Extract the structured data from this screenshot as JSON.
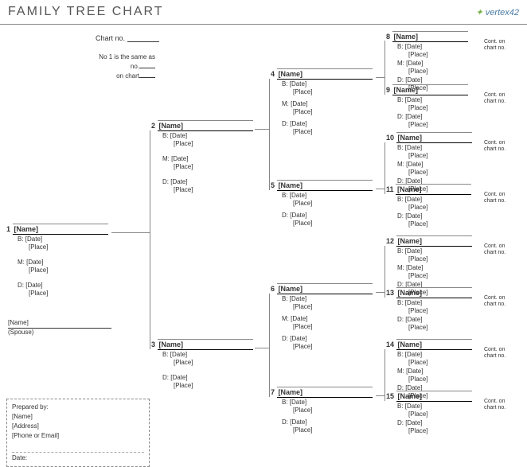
{
  "header": {
    "title": "FAMILY TREE CHART",
    "logo": "vertex42"
  },
  "chartno": {
    "label": "Chart no.",
    "value": ""
  },
  "instructions": {
    "line1": "No 1 is the same as",
    "line2": "no.",
    "line3": "on chart"
  },
  "labels": {
    "b": "B:",
    "m": "M:",
    "d": "D:",
    "date": "[Date]",
    "place": "[Place]",
    "name": "[Name]",
    "cont": "Cont. on chart no."
  },
  "spouse": {
    "label": "(Spouse)",
    "name": "[Name]"
  },
  "prep": {
    "by": "Prepared by:",
    "name": "[Name]",
    "addr": "[Address]",
    "phone": "[Phone or Email]",
    "date": "Date:"
  },
  "p1": {
    "n": "1"
  },
  "p2": {
    "n": "2"
  },
  "p3": {
    "n": "3"
  },
  "p4": {
    "n": "4"
  },
  "p5": {
    "n": "5"
  },
  "p6": {
    "n": "6"
  },
  "p7": {
    "n": "7"
  },
  "p8": {
    "n": "8"
  },
  "p9": {
    "n": "9"
  },
  "p10": {
    "n": "10"
  },
  "p11": {
    "n": "11"
  },
  "p12": {
    "n": "12"
  },
  "p13": {
    "n": "13"
  },
  "p14": {
    "n": "14"
  },
  "p15": {
    "n": "15"
  }
}
